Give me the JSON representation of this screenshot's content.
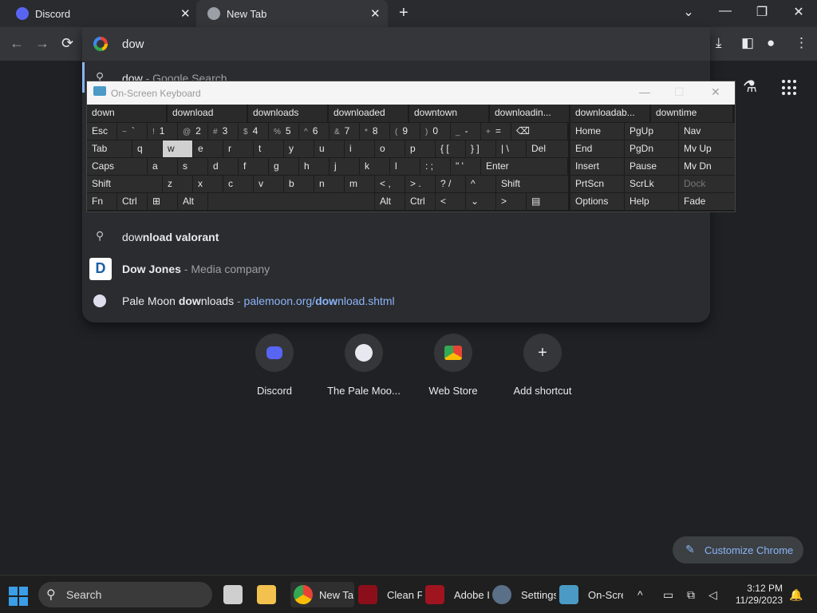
{
  "tabs": [
    {
      "label": "Discord",
      "close": "✕"
    },
    {
      "label": "New Tab",
      "close": "✕"
    }
  ],
  "newtab": "+",
  "window_controls": [
    "⌄",
    "—",
    "❐",
    "✕"
  ],
  "nav": [
    "←",
    "→",
    "⟳"
  ],
  "omnibox": {
    "query": "dow"
  },
  "suggestions": [
    {
      "pre": "dow",
      "post": " - Google Search"
    },
    {
      "pre": "dow",
      "bold": "nload valorant"
    },
    {
      "bold": "Dow Jones",
      "post": " - Media company"
    },
    {
      "pre": "Pale Moon ",
      "bold": "dow",
      "tail": "nloads",
      "dash": " - ",
      "url_pre": "palemoon.org/",
      "url_bold": "dow",
      "url_post": "nload.shtml"
    }
  ],
  "osk": {
    "title": "On-Screen Keyboard",
    "predictions": [
      "down",
      "download",
      "downloads",
      "downloaded",
      "downtown",
      "downloadin...",
      "downloadab...",
      "downtime"
    ],
    "row1": [
      [
        "",
        "Esc"
      ],
      [
        "~",
        "`"
      ],
      [
        "!",
        "1"
      ],
      [
        "@",
        "2"
      ],
      [
        "#",
        "3"
      ],
      [
        "$",
        "4"
      ],
      [
        "%",
        "5"
      ],
      [
        "^",
        "6"
      ],
      [
        "&",
        "7"
      ],
      [
        "*",
        "8"
      ],
      [
        "(",
        "9"
      ],
      [
        ")",
        "0"
      ],
      [
        "_",
        "-"
      ],
      [
        "+",
        "="
      ],
      [
        "",
        "⌫"
      ],
      [
        "",
        "Home"
      ],
      [
        "",
        "PgUp"
      ],
      [
        "",
        "Nav"
      ]
    ],
    "row2": [
      "Tab",
      "q",
      "w",
      "e",
      "r",
      "t",
      "y",
      "u",
      "i",
      "o",
      "p",
      "{ [",
      "} ]",
      "| \\",
      "Del",
      "End",
      "PgDn",
      "Mv Up"
    ],
    "row3": [
      "Caps",
      "a",
      "s",
      "d",
      "f",
      "g",
      "h",
      "j",
      "k",
      "l",
      ": ;",
      "\" '",
      "Enter",
      "Insert",
      "Pause",
      "Mv Dn"
    ],
    "row4": [
      "Shift",
      "z",
      "x",
      "c",
      "v",
      "b",
      "n",
      "m",
      "< ,",
      "> .",
      "? /",
      "^",
      "Shift",
      "PrtScn",
      "ScrLk",
      "Dock"
    ],
    "row5": [
      "Fn",
      "Ctrl",
      "⊞",
      "Alt",
      "Alt",
      "Ctrl",
      "<",
      "⌄",
      ">",
      "▤",
      "Options",
      "Help",
      "Fade"
    ]
  },
  "shortcuts": [
    {
      "name": "Discord"
    },
    {
      "name": "The Pale Moo..."
    },
    {
      "name": "Web Store"
    },
    {
      "name": "Add shortcut",
      "icon": "+"
    }
  ],
  "customize": "Customize Chrome",
  "taskbar": {
    "search": "Search",
    "apps": [
      "New Tab",
      "Clean Fl",
      "Adobe I",
      "Settings",
      "On-Scre"
    ],
    "time": "3:12 PM",
    "date": "11/29/2023"
  }
}
